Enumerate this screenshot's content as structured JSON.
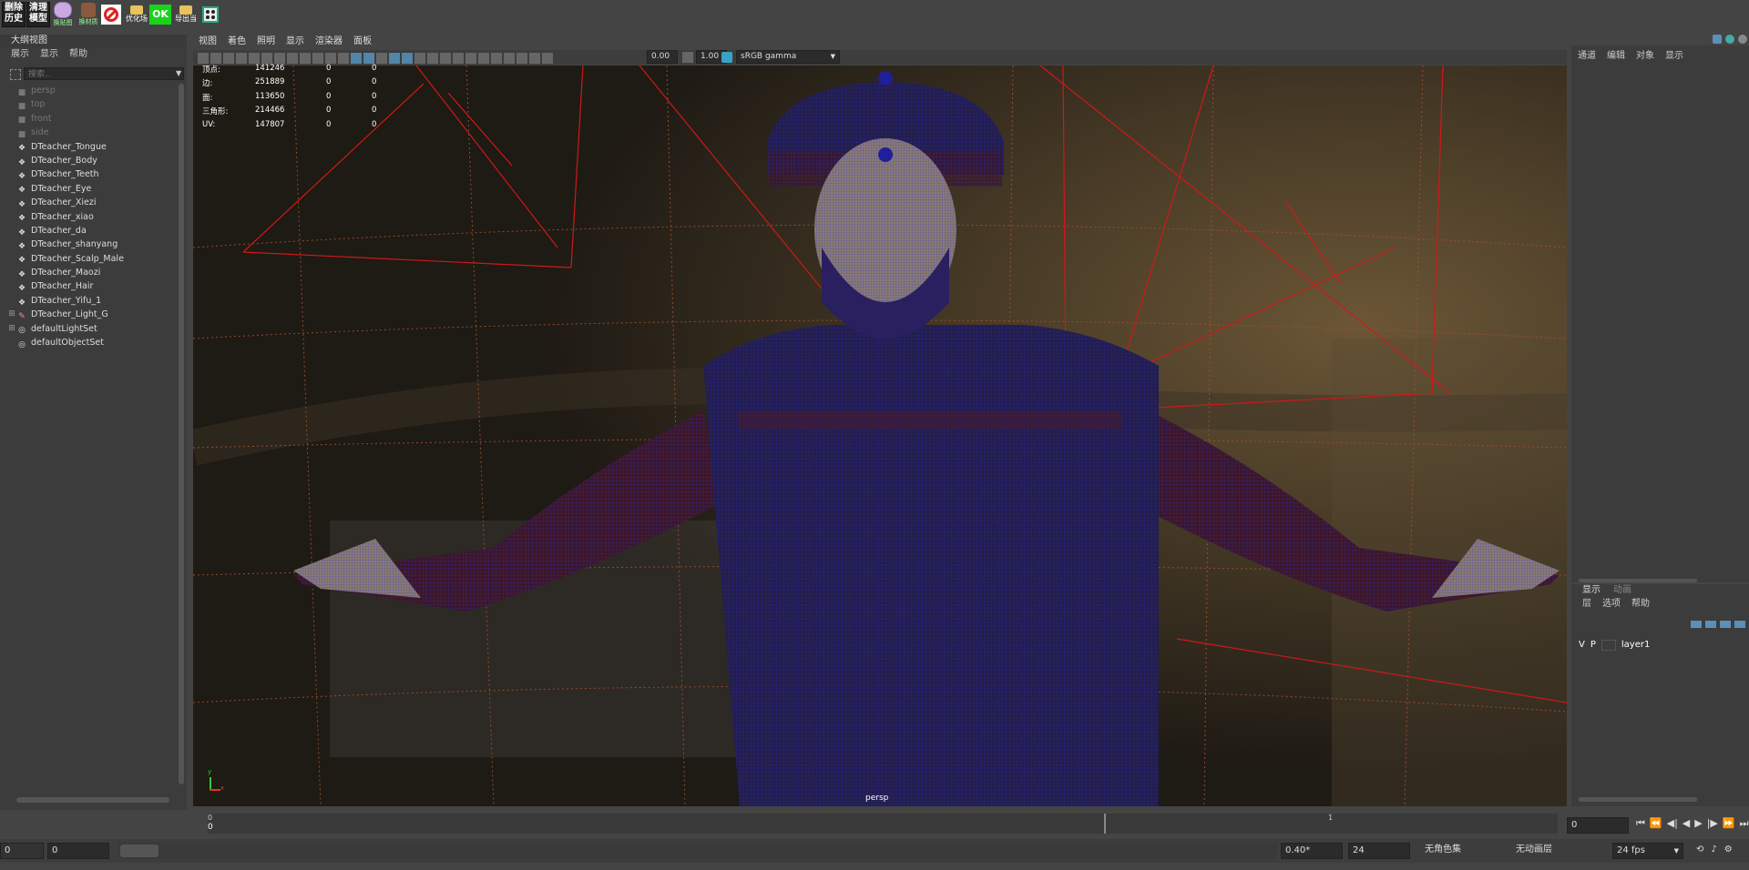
{
  "shelf": {
    "buttons": [
      {
        "label": "删除\n历史",
        "icon": "text-badge"
      },
      {
        "label": "清理\n模型",
        "icon": "text-badge"
      },
      {
        "label": "换贴图",
        "icon": "anime-face-icon"
      },
      {
        "label": "换材质",
        "icon": "person-face-icon"
      },
      {
        "label": "",
        "icon": "no-sign-icon"
      },
      {
        "label": "优化场",
        "icon": "folder-icon"
      },
      {
        "label": "OK",
        "icon": "ok-badge"
      },
      {
        "label": "导出当",
        "icon": "folder-icon"
      },
      {
        "label": "",
        "icon": "dice-icon"
      }
    ]
  },
  "outliner": {
    "title": "大纲视图",
    "menu": [
      "展示",
      "显示",
      "帮助"
    ],
    "search_placeholder": "搜索...",
    "items": [
      {
        "label": "persp",
        "type": "camera"
      },
      {
        "label": "top",
        "type": "camera"
      },
      {
        "label": "front",
        "type": "camera"
      },
      {
        "label": "side",
        "type": "camera"
      },
      {
        "label": "DTeacher_Tongue",
        "type": "mesh"
      },
      {
        "label": "DTeacher_Body",
        "type": "mesh"
      },
      {
        "label": "DTeacher_Teeth",
        "type": "mesh"
      },
      {
        "label": "DTeacher_Eye",
        "type": "mesh"
      },
      {
        "label": "DTeacher_Xiezi",
        "type": "mesh"
      },
      {
        "label": "DTeacher_xiao",
        "type": "mesh"
      },
      {
        "label": "DTeacher_da",
        "type": "mesh"
      },
      {
        "label": "DTeacher_shanyang",
        "type": "mesh"
      },
      {
        "label": "DTeacher_Scalp_Male",
        "type": "mesh"
      },
      {
        "label": "DTeacher_Maozi",
        "type": "mesh"
      },
      {
        "label": "DTeacher_Hair",
        "type": "mesh"
      },
      {
        "label": "DTeacher_Yifu_1",
        "type": "mesh"
      },
      {
        "label": "DTeacher_Light_G",
        "type": "light-group"
      },
      {
        "label": "defaultLightSet",
        "type": "set"
      },
      {
        "label": "defaultObjectSet",
        "type": "set"
      }
    ]
  },
  "viewport": {
    "menu": [
      "视图",
      "着色",
      "照明",
      "显示",
      "渲染器",
      "面板"
    ],
    "exposure": "0.00",
    "gamma": "1.00",
    "color_space": "sRGB gamma",
    "camera_label": "persp",
    "axis_x": "x",
    "axis_y": "y",
    "hud": [
      {
        "label": "顶点:",
        "v1": "141246",
        "v2": "0",
        "v3": "0"
      },
      {
        "label": "边:",
        "v1": "251889",
        "v2": "0",
        "v3": "0"
      },
      {
        "label": "面:",
        "v1": "113650",
        "v2": "0",
        "v3": "0"
      },
      {
        "label": "三角形:",
        "v1": "214466",
        "v2": "0",
        "v3": "0"
      },
      {
        "label": "UV:",
        "v1": "147807",
        "v2": "0",
        "v3": "0"
      }
    ]
  },
  "channel_box": {
    "menu": [
      "通道",
      "编辑",
      "对象",
      "显示"
    ]
  },
  "layer_editor": {
    "tabs": [
      "显示",
      "动画"
    ],
    "menu": [
      "层",
      "选项",
      "帮助"
    ],
    "layer": {
      "v": "V",
      "p": "P",
      "name": "layer1"
    }
  },
  "timeline": {
    "start_label": "0",
    "start_tick": "0",
    "mid_tick": "1",
    "current_frame": "0"
  },
  "status_bar": {
    "start_frame": "0",
    "anim_start": "0",
    "value": "0.40*",
    "end_frame": "24",
    "character_set": "无角色集",
    "anim_layer": "无动画层",
    "fps": "24 fps"
  },
  "colors": {
    "bg": "#444444",
    "panel": "#3c3c3c",
    "field": "#2b2b2b",
    "accent": "#5285a6",
    "wireframe": "#1a1aaa"
  }
}
